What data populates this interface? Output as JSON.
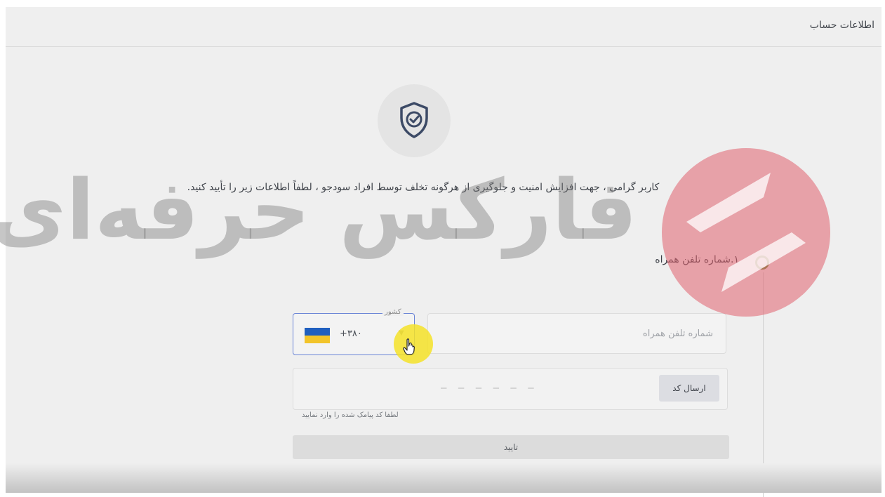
{
  "header": {
    "title": "اطلاعات حساب"
  },
  "intro_text": "کاربر گرامی ، جهت افزایش امنیت و جلوگیری از هرگونه تخلف توسط افراد سودجو ، لطفاً اطلاعات زیر را تأیید کنید.",
  "step": {
    "label": "۱.شماره تلفن همراه"
  },
  "country_select": {
    "legend": "کشور",
    "dial_code": "+۳۸۰",
    "flag_icon": "ukraine-flag"
  },
  "phone_field": {
    "placeholder": "شماره تلفن همراه",
    "value": ""
  },
  "send_code_button": {
    "label": "ارسال کد"
  },
  "code_field": {
    "dashes": "— — — — — —",
    "hint": "لطفا کد پیامک شده را وارد نمایید"
  },
  "confirm_button": {
    "label": "تایید"
  },
  "watermark": {
    "text": "فارکس حرفه‌ای"
  },
  "colors": {
    "accent_border": "#6a84d6",
    "step_ring": "#6b8e3a",
    "watermark_logo": "#e0606e",
    "cursor_highlight": "#f4e228"
  },
  "icons": {
    "shield": "shield-check-icon",
    "dropdown": "chevron-down-icon",
    "cursor": "hand-pointer-icon"
  }
}
